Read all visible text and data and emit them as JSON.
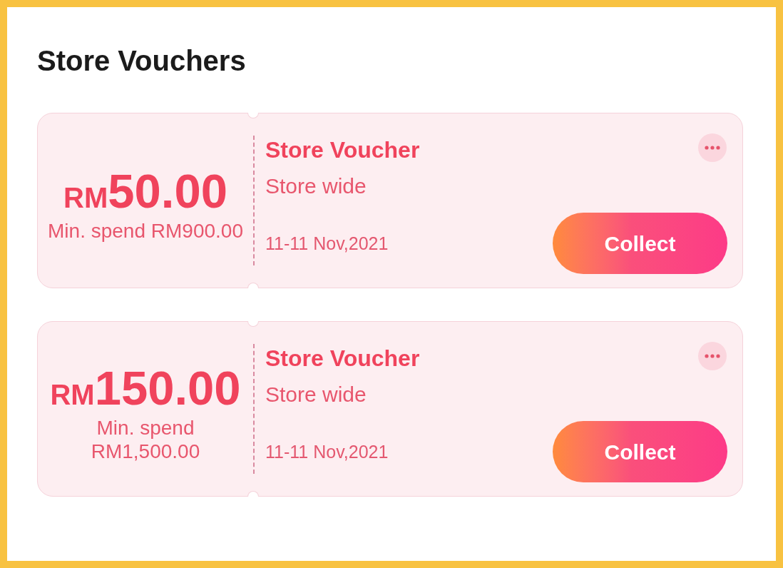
{
  "title": "Store Vouchers",
  "vouchers": [
    {
      "currency": "RM",
      "amount": "50.00",
      "min_spend": "Min. spend RM900.00",
      "name": "Store Voucher",
      "scope": "Store wide",
      "validity": "11-11 Nov,2021",
      "button": "Collect"
    },
    {
      "currency": "RM",
      "amount": "150.00",
      "min_spend": "Min. spend RM1,500.00",
      "name": "Store Voucher",
      "scope": "Store wide",
      "validity": "11-11 Nov,2021",
      "button": "Collect"
    }
  ]
}
